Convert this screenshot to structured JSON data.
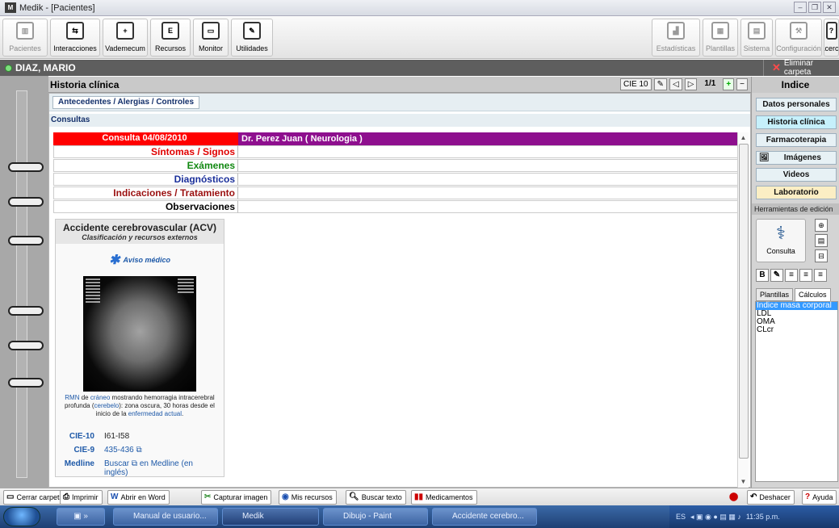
{
  "window": {
    "title": "Medik - [Pacientes]",
    "app_icon": "M"
  },
  "toolbar": {
    "left": [
      {
        "label": "Pacientes",
        "icon": "folder-icon",
        "disabled": true
      },
      {
        "label": "Interacciones",
        "icon": "interactions-icon",
        "disabled": false
      },
      {
        "label": "Vademecum",
        "icon": "vademecum-icon",
        "disabled": false
      },
      {
        "label": "Recursos",
        "icon": "resources-icon",
        "disabled": false
      },
      {
        "label": "Monitor",
        "icon": "monitor-icon",
        "disabled": false
      },
      {
        "label": "Utilidades",
        "icon": "utilities-icon",
        "disabled": false
      }
    ],
    "right": [
      {
        "label": "Estadísticas",
        "icon": "chart-icon",
        "disabled": true
      },
      {
        "label": "Plantillas",
        "icon": "template-icon",
        "disabled": true
      },
      {
        "label": "Sistema",
        "icon": "system-icon",
        "disabled": true
      },
      {
        "label": "Configuración",
        "icon": "settings-icon",
        "disabled": true
      },
      {
        "label": "Acerca",
        "icon": "help-icon",
        "disabled": false
      }
    ]
  },
  "patient": {
    "name": "DIAZ, MARIO",
    "delete_label": "Eliminar carpeta"
  },
  "historia": {
    "title": "Historia clínica",
    "cie_label": "CIE 10",
    "page": "1/1",
    "antecedentes_label": "Antecedentes / Alergias / Controles",
    "consultas_label": "Consultas"
  },
  "consulta": {
    "header_left": "Consulta  04/08/2010",
    "header_right": "Dr. Perez Juan ( Neurologia )",
    "fields": [
      {
        "label": "Síntomas / Signos",
        "color": "#e00000"
      },
      {
        "label": "Exámenes",
        "color": "#118811"
      },
      {
        "label": "Diagnósticos",
        "color": "#1a2f9a"
      },
      {
        "label": "Indicaciones / Tratamiento",
        "color": "#9b1010"
      },
      {
        "label": "Observaciones",
        "color": "#000000"
      }
    ]
  },
  "wiki": {
    "title": "Accidente cerebrovascular (ACV)",
    "subtitle": "Clasificación y recursos externos",
    "aviso": "Aviso médico",
    "caption_1": "RMN",
    "caption_2": " de ",
    "caption_3": "cráneo",
    "caption_4": " mostrando hemorragia intracerebral profunda (",
    "caption_5": "cerebelo",
    "caption_6": "): zona oscura, 30 horas desde el inicio de la ",
    "caption_7": "enfermedad actual",
    "caption_8": ".",
    "rows": [
      {
        "k": "CIE-10",
        "v": "I61-I58"
      },
      {
        "k": "CIE-9",
        "v": "435-436 ⧉"
      },
      {
        "k": "Medline",
        "v": "Buscar ⧉ en Medline (en inglés)"
      }
    ]
  },
  "indice": {
    "title": "Indice",
    "buttons": [
      "Datos personales",
      "Historia clínica",
      "Farmacoterapia",
      "Imágenes",
      "Videos",
      "Laboratorio"
    ],
    "herramientas": "Herramientas de edición",
    "consulta_btn": "Consulta",
    "tabs": [
      "Plantillas",
      "Cálculos"
    ],
    "calculos": [
      "Indice masa corporal",
      "LDL",
      "OMA",
      "CLcr"
    ]
  },
  "bottom": [
    {
      "label": "Cerrar carpeta",
      "icon": "folder-icon"
    },
    {
      "label": "Imprimir",
      "icon": "printer-icon"
    },
    {
      "label": "Abrir en Word",
      "icon": "word-icon"
    },
    {
      "label": "Capturar imagen",
      "icon": "capture-icon"
    },
    {
      "label": "Mis recursos",
      "icon": "resources-icon"
    },
    {
      "label": "Buscar texto",
      "icon": "search-icon"
    },
    {
      "label": "Medicamentos",
      "icon": "medicine-icon"
    }
  ],
  "bottom_right": [
    {
      "label": "Deshacer",
      "icon": "undo-icon"
    },
    {
      "label": "Ayuda",
      "icon": "help-icon"
    }
  ],
  "taskbar": {
    "items": [
      "Manual de usuario...",
      "Medik",
      "Dibujo - Paint",
      "Accidente cerebro..."
    ],
    "lang": "ES",
    "clock": "11:35 p.m."
  }
}
